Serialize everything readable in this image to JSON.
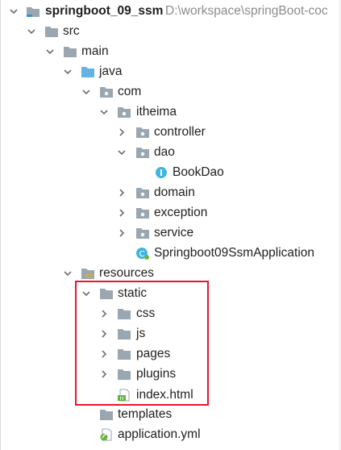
{
  "project": {
    "name": "springboot_09_ssm",
    "path": "D:\\workspace\\springBoot-coc"
  },
  "tree": {
    "src": "src",
    "main": "main",
    "java": "java",
    "com": "com",
    "itheima": "itheima",
    "controller": "controller",
    "dao": "dao",
    "bookdao": "BookDao",
    "domain": "domain",
    "exception": "exception",
    "service": "service",
    "application_class": "Springboot09SsmApplication",
    "resources": "resources",
    "static": "static",
    "css": "css",
    "js": "js",
    "pages": "pages",
    "plugins": "plugins",
    "index_html": "index.html",
    "templates": "templates",
    "application_yml": "application.yml"
  },
  "colors": {
    "highlight": "#e8162b",
    "folder": "#9aa7b0",
    "source_folder": "#62b3e4",
    "interface_icon": "#40b6e0",
    "spring_icon": "#6db33f"
  }
}
